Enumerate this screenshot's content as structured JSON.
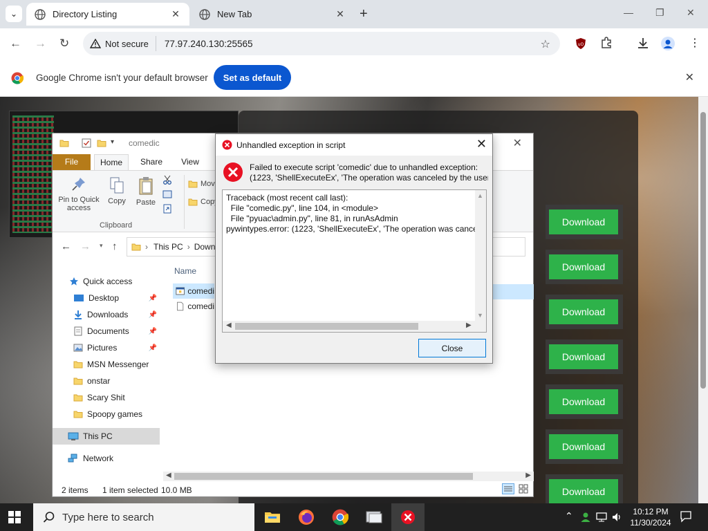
{
  "browser": {
    "tabs": [
      {
        "title": "Directory Listing",
        "active": true
      },
      {
        "title": "New Tab",
        "active": false
      }
    ],
    "address": {
      "security_label": "Not secure",
      "url": "77.97.240.130:25565"
    },
    "infobar": {
      "message": "Google Chrome isn't your default browser",
      "button": "Set as default"
    }
  },
  "webpage": {
    "heading_partial": "",
    "download_buttons": [
      "Download",
      "Download",
      "Download",
      "Download",
      "Download",
      "Download",
      "Download"
    ]
  },
  "explorer": {
    "title": "comedic",
    "ribbon_tabs": [
      "File",
      "Home",
      "Share",
      "View"
    ],
    "ribbon_buttons": {
      "pin": "Pin to Quick access",
      "copy": "Copy",
      "paste": "Paste",
      "move": "Move",
      "copy_to": "Copy",
      "group": "Clipboard"
    },
    "address": {
      "segments": [
        "This PC",
        "Down"
      ]
    },
    "column_header": "Name",
    "nav": [
      {
        "label": "Quick access",
        "pinned": false
      },
      {
        "label": "Desktop",
        "pinned": true
      },
      {
        "label": "Downloads",
        "pinned": true
      },
      {
        "label": "Documents",
        "pinned": true
      },
      {
        "label": "Pictures",
        "pinned": true
      },
      {
        "label": "MSN Messenger",
        "pinned": false
      },
      {
        "label": "onstar",
        "pinned": false
      },
      {
        "label": "Scary Shit",
        "pinned": false
      },
      {
        "label": "Spoopy games",
        "pinned": false
      },
      {
        "label": "This PC",
        "pinned": false
      },
      {
        "label": "Network",
        "pinned": false
      }
    ],
    "files": [
      "comedi",
      "comedi"
    ],
    "status": {
      "items": "2 items",
      "selected": "1 item selected",
      "size": "10.0 MB"
    }
  },
  "dialog": {
    "title": "Unhandled exception in script",
    "message_line1": "Failed to execute script 'comedic' due to unhandled exception:",
    "message_line2": "(1223, 'ShellExecuteEx', 'The operation was canceled by the user.')",
    "traceback": "Traceback (most recent call last):\n  File \"comedic.py\", line 104, in <module>\n  File \"pyuac\\admin.py\", line 81, in runAsAdmin\npywintypes.error: (1223, 'ShellExecuteEx', 'The operation was canceled by the user.')",
    "close_button": "Close"
  },
  "taskbar": {
    "search_placeholder": "Type here to search",
    "time": "10:12 PM",
    "date": "11/30/2024"
  },
  "colors": {
    "download_green": "#2eb24a",
    "chrome_blue": "#0b57d0",
    "file_tab": "#b57b19",
    "error_red": "#e81123"
  }
}
